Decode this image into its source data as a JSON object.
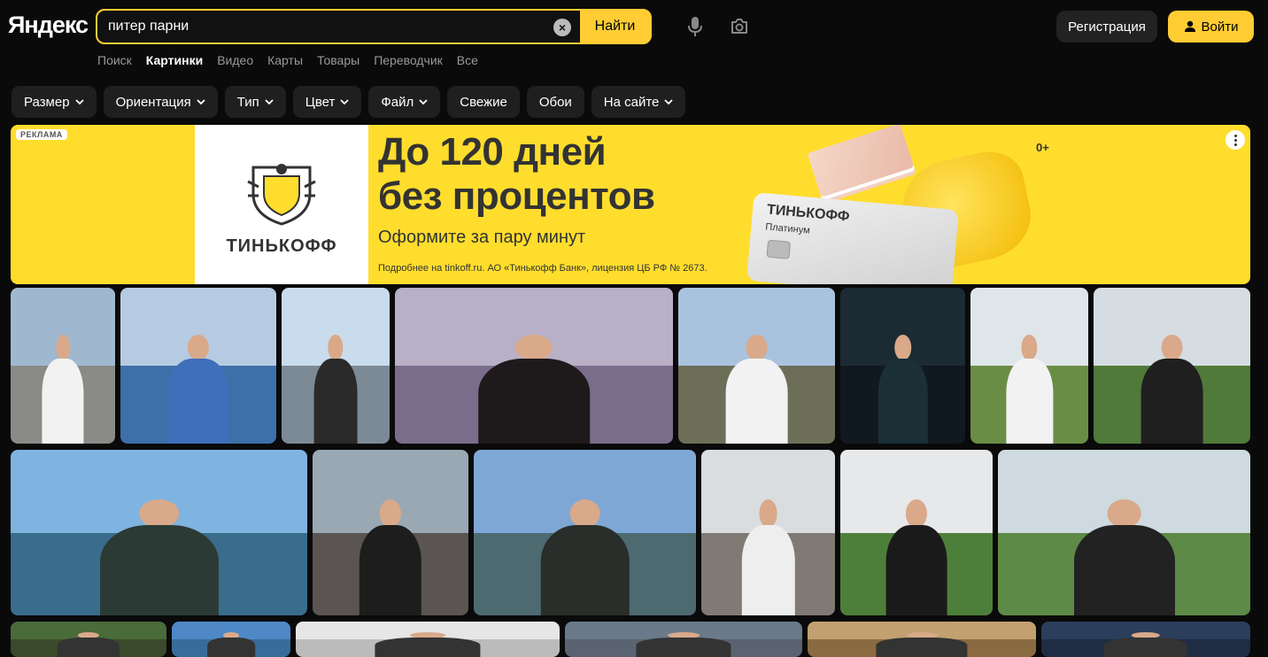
{
  "header": {
    "logo": "Яндекс",
    "search_value": "питер парни",
    "search_button": "Найти",
    "register_label": "Регистрация",
    "login_label": "Войти"
  },
  "nav": {
    "items": [
      "Поиск",
      "Картинки",
      "Видео",
      "Карты",
      "Товары",
      "Переводчик",
      "Все"
    ],
    "active": "Картинки"
  },
  "filters": {
    "items": [
      {
        "label": "Размер",
        "dropdown": true
      },
      {
        "label": "Ориентация",
        "dropdown": true
      },
      {
        "label": "Тип",
        "dropdown": true
      },
      {
        "label": "Цвет",
        "dropdown": true
      },
      {
        "label": "Файл",
        "dropdown": true
      },
      {
        "label": "Свежие",
        "dropdown": false
      },
      {
        "label": "Обои",
        "dropdown": false
      },
      {
        "label": "На сайте",
        "dropdown": true
      }
    ]
  },
  "ad": {
    "label": "РЕКЛАМА",
    "brand": "ТИНЬКОФФ",
    "headline_1": "До 120 дней",
    "headline_2": "без процентов",
    "subline": "Оформите за пару минут",
    "fine_print": "Подробнее на tinkoff.ru. АО «Тинькофф Банк», лицензия ЦБ РФ № 2673.",
    "age": "0+",
    "card_brand": "ТИНЬКОФФ",
    "card_type": "Платинум",
    "colors": {
      "background": "#ffdd2d",
      "text": "#333333"
    }
  },
  "colors": {
    "accent": "#ffcc33",
    "page_bg": "#0a0a0a",
    "chip_bg": "#1f1f1f"
  },
  "images": {
    "row1": [
      {
        "sky": "#9fb8d0",
        "ground": "#8a8a86",
        "shirt": "#f2f2f2"
      },
      {
        "sky": "#b6cbe2",
        "ground": "#3d6fa8",
        "shirt": "#3f6fb8"
      },
      {
        "sky": "#c9dcee",
        "ground": "#7c8a96",
        "shirt": "#2a2a2a"
      },
      {
        "sky": "#b8b0c6",
        "ground": "#7a6d8c",
        "shirt": "#1e1a1c"
      },
      {
        "sky": "#a9c2de",
        "ground": "#6d6e58",
        "shirt": "#f2f2f2"
      },
      {
        "sky": "#1b2a33",
        "ground": "#10191f",
        "shirt": "#1b2f36"
      },
      {
        "sky": "#dfe6ea",
        "ground": "#6a8d46",
        "shirt": "#f2f2f2"
      },
      {
        "sky": "#d6dde2",
        "ground": "#4f7a3a",
        "shirt": "#1f1f1f"
      }
    ],
    "row2": [
      {
        "sky": "#7fb3e0",
        "ground": "#3a6c8c",
        "shirt": "#2c3a36"
      },
      {
        "sky": "#9aa8b4",
        "ground": "#5a5552",
        "shirt": "#1d1d1d"
      },
      {
        "sky": "#7fa7d6",
        "ground": "#4c6a70",
        "shirt": "#2a2e2a"
      },
      {
        "sky": "#d9dde0",
        "ground": "#807a74",
        "shirt": "#eeeeee"
      },
      {
        "sky": "#e6e8ea",
        "ground": "#4e7f3a",
        "shirt": "#1a1a1a"
      },
      {
        "sky": "#cfd9e0",
        "ground": "#5e8a48",
        "shirt": "#222222"
      }
    ],
    "row3": [
      {
        "sky": "#4a6b3a",
        "ground": "#3a4a2a",
        "shirt": "#333333"
      },
      {
        "sky": "#4f88c7",
        "ground": "#3a6c9a",
        "shirt": "#333333"
      },
      {
        "sky": "#e6e6e6",
        "ground": "#bbbbbb",
        "shirt": "#333333"
      },
      {
        "sky": "#6a7a8a",
        "ground": "#5a6470",
        "shirt": "#333333"
      },
      {
        "sky": "#c2a070",
        "ground": "#8a6a40",
        "shirt": "#333333"
      },
      {
        "sky": "#2b3e5c",
        "ground": "#1f2c44",
        "shirt": "#333333"
      },
      {
        "sky": "#dfe4e8",
        "ground": "#b8c0c6",
        "shirt": "#333333"
      }
    ]
  }
}
